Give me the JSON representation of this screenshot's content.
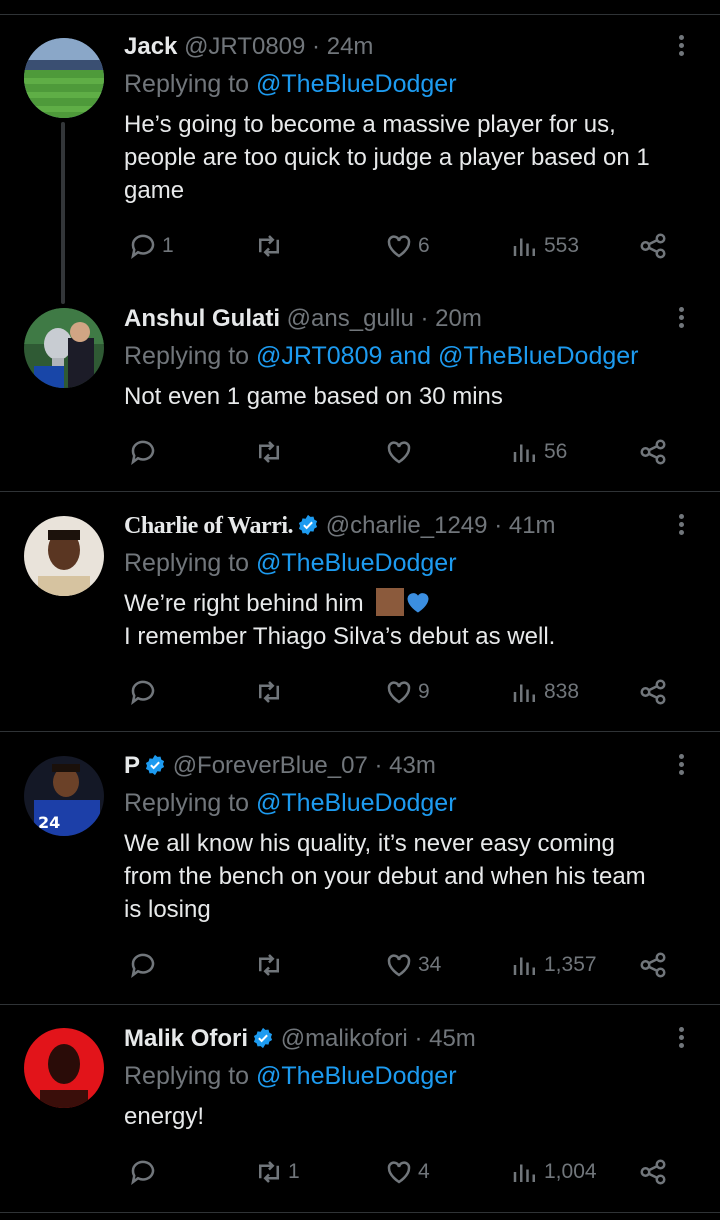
{
  "tweets": [
    {
      "name": "Jack",
      "handle": "@JRT0809",
      "dot": "·",
      "time": "24m",
      "verified": false,
      "replying_prefix": "Replying to",
      "replying_to": "@TheBlueDodger",
      "text_lines": [
        "He’s going to become a massive player for us,",
        "people are too quick to judge a player based on 1",
        "game"
      ],
      "replies": "1",
      "retweets": "",
      "likes": "6",
      "views": "553",
      "avatar_icon": "stadium-avatar"
    },
    {
      "name": "Anshul Gulati",
      "handle": "@ans_gullu",
      "dot": "·",
      "time": "20m",
      "verified": false,
      "replying_prefix": "Replying to",
      "replying_to": "@JRT0809 and @TheBlueDodger",
      "text_lines": [
        "Not even 1 game based on 30 mins"
      ],
      "replies": "",
      "retweets": "",
      "likes": "",
      "views": "56",
      "avatar_icon": "trophy-avatar"
    },
    {
      "name": "Charlie of Warri.",
      "handle": "@charlie_1249",
      "dot": "·",
      "time": "41m",
      "verified": true,
      "replying_prefix": "Replying to",
      "replying_to": "@TheBlueDodger",
      "text_lines": [
        "We’re right behind him",
        "I remember Thiago Silva’s debut as well."
      ],
      "replies": "",
      "retweets": "",
      "likes": "9",
      "views": "838",
      "avatar_icon": "person-avatar"
    },
    {
      "name": "P",
      "handle": "@ForeverBlue_07",
      "dot": "·",
      "time": "43m",
      "verified": true,
      "replying_prefix": "Replying to",
      "replying_to": "@TheBlueDodger",
      "text_lines": [
        "We all know his quality, it’s never easy coming",
        "from the bench on your debut and when his team",
        "is losing"
      ],
      "replies": "",
      "retweets": "",
      "likes": "34",
      "views": "1,357",
      "avatar_icon": "player-avatar"
    },
    {
      "name": "Malik Ofori",
      "handle": "@malikofori",
      "dot": "·",
      "time": "45m",
      "verified": true,
      "replying_prefix": "Replying to",
      "replying_to": "@TheBlueDodger",
      "text_lines": [
        "energy!"
      ],
      "replies": "",
      "retweets": "1",
      "likes": "4",
      "views": "1,004",
      "avatar_icon": "red-avatar"
    }
  ],
  "colors": {
    "background": "#000000",
    "text": "#e7e9ea",
    "muted": "#71767b",
    "link": "#1d9bf0",
    "divider": "#2f3336"
  }
}
